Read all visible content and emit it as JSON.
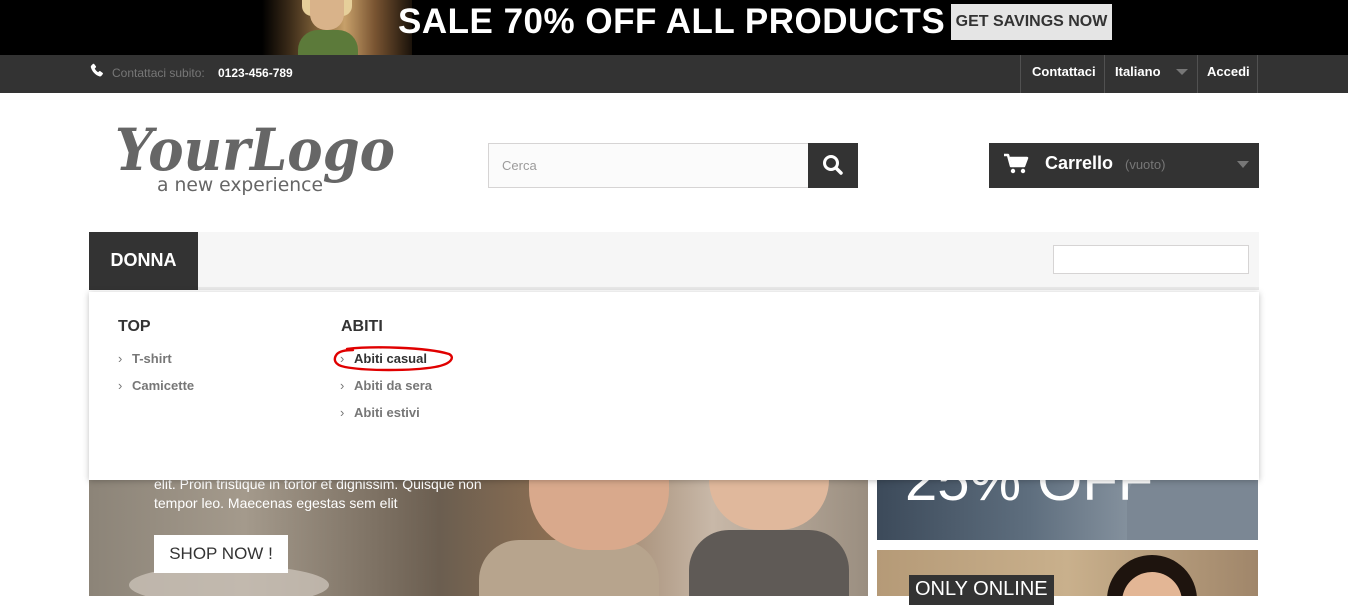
{
  "banner": {
    "headline": "SALE 70% OFF ALL PRODUCTS",
    "cta_label": "GET SAVINGS NOW"
  },
  "topbar": {
    "contact_label": "Contattaci subito:",
    "contact_phone": "0123-456-789",
    "links": {
      "contact": "Contattaci",
      "language": "Italiano",
      "login": "Accedi"
    }
  },
  "header": {
    "logo_text_main": "YourLogo",
    "logo_text_sub": "a new experience",
    "search_placeholder": "Cerca",
    "cart_label": "Carrello",
    "cart_status": "(vuoto)"
  },
  "menu": {
    "active_item": "DONNA",
    "dropdown": {
      "columns": [
        {
          "title": "TOP",
          "items": [
            "T-shirt",
            "Camicette"
          ]
        },
        {
          "title": "ABITI",
          "items": [
            "Abiti casual",
            "Abiti da sera",
            "Abiti estivi"
          ]
        }
      ],
      "highlighted_item": "Abiti casual"
    }
  },
  "slider": {
    "text": "elit. Proin tristique in tortor et dignissim. Quisque non tempor leo. Maecenas egestas sem elit",
    "button_label": "SHOP NOW !"
  },
  "promos": {
    "first": "25% OFF",
    "second": "ONLY ONLINE"
  },
  "colors": {
    "dark": "#333333",
    "annotation_red": "#e00000",
    "muted_text": "#777777"
  },
  "icons": {
    "phone": "phone-icon",
    "search": "search-icon",
    "cart": "cart-icon",
    "caret": "caret-down-icon"
  }
}
